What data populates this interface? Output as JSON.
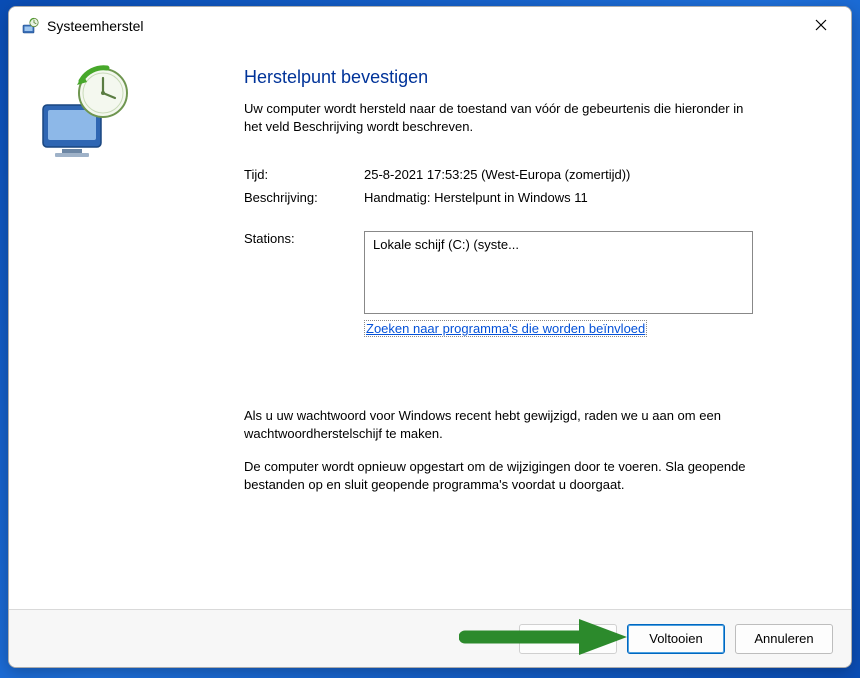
{
  "title": "Systeemherstel",
  "heading": "Herstelpunt bevestigen",
  "subtext": "Uw computer wordt hersteld naar de toestand van vóór de gebeurtenis die hieronder in het veld Beschrijving wordt beschreven.",
  "labels": {
    "time": "Tijd:",
    "description": "Beschrijving:",
    "stations": "Stations:"
  },
  "values": {
    "time": "25-8-2021 17:53:25 (West-Europa (zomertijd))",
    "description": "Handmatig: Herstelpunt in Windows 11",
    "station": "Lokale schijf (C:) (syste..."
  },
  "affected_link": "Zoeken naar programma's die worden beïnvloed",
  "lower": {
    "p1": "Als u uw wachtwoord voor Windows recent hebt gewijzigd, raden we u aan om een wachtwoordherstelschijf te maken.",
    "p2": "De computer wordt opnieuw opgestart om de wijzigingen door te voeren. Sla geopende bestanden op en sluit geopende programma's voordat u doorgaat."
  },
  "buttons": {
    "back": " ",
    "finish": "Voltooien",
    "cancel": "Annuleren"
  }
}
